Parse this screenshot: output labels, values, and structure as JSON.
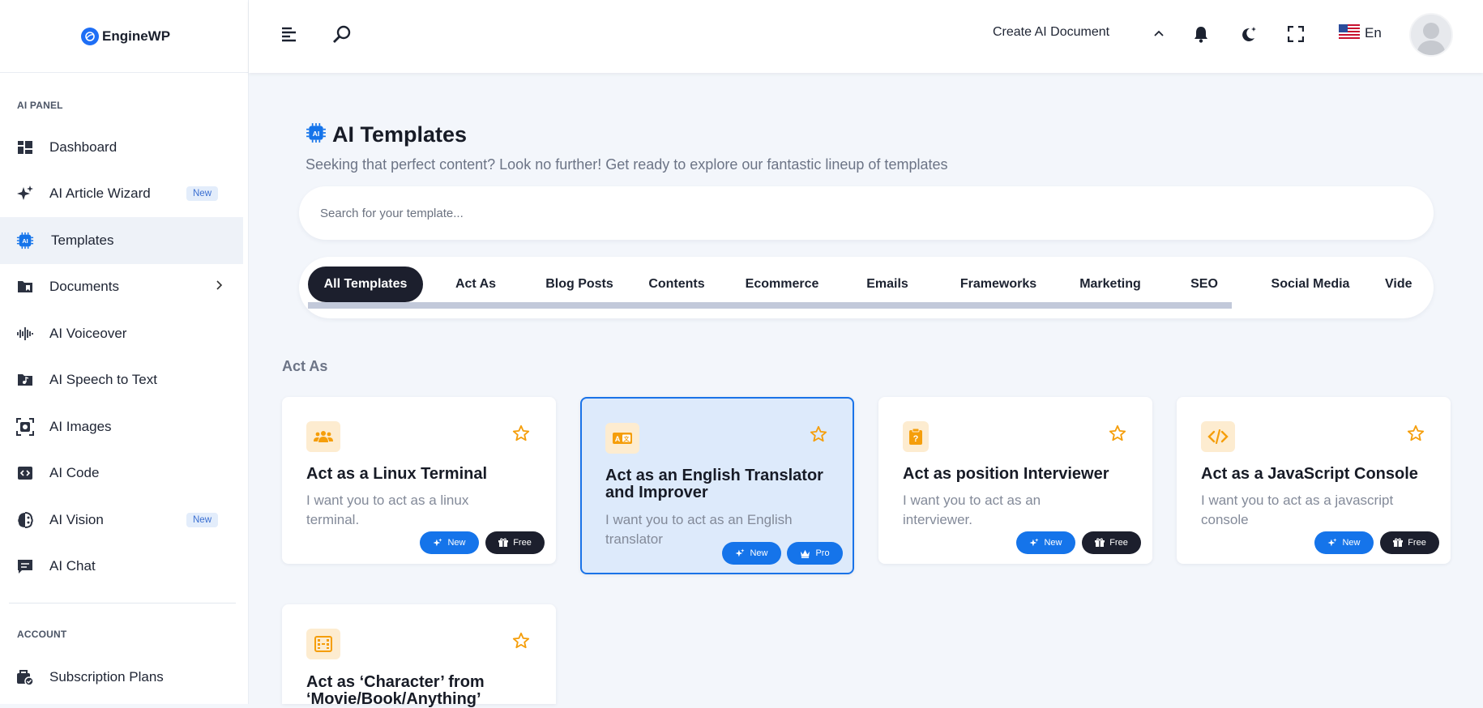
{
  "app": {
    "logo_text": "EngineWP"
  },
  "colors": {
    "accent": "#1574ea",
    "dark": "#1c1f2d",
    "icon_orange": "#f59e0b",
    "icon_bg": "#fdecd0",
    "highlight_bg": "#ddeafb"
  },
  "sidebar": {
    "section_ai": "AI PANEL",
    "section_account": "ACCOUNT",
    "items": [
      {
        "label": "Dashboard",
        "icon": "dashboard-icon"
      },
      {
        "label": "AI Article Wizard",
        "icon": "sparkles-icon",
        "badge": "New"
      },
      {
        "label": "Templates",
        "icon": "ai-chip-icon",
        "active": true
      },
      {
        "label": "Documents",
        "icon": "folder-icon",
        "chevron": true
      },
      {
        "label": "AI Voiceover",
        "icon": "waveform-icon"
      },
      {
        "label": "AI Speech to Text",
        "icon": "music-file-icon"
      },
      {
        "label": "AI Images",
        "icon": "image-scan-icon"
      },
      {
        "label": "AI Code",
        "icon": "code-icon"
      },
      {
        "label": "AI Vision",
        "icon": "brain-icon",
        "badge": "New"
      },
      {
        "label": "AI Chat",
        "icon": "chat-icon"
      }
    ],
    "account_items": [
      {
        "label": "Subscription Plans",
        "icon": "subscription-icon"
      }
    ]
  },
  "topbar": {
    "create_doc": "Create AI Document",
    "language": "En"
  },
  "main": {
    "title": "AI Templates",
    "subtitle": "Seeking that perfect content? Look no further! Get ready to explore our fantastic lineup of templates",
    "search_placeholder": "Search for your template...",
    "tabs": [
      "All Templates",
      "Act As",
      "Blog Posts",
      "Contents",
      "Ecommerce",
      "Emails",
      "Frameworks",
      "Marketing",
      "SEO",
      "Social Media",
      "Vide"
    ],
    "active_tab": "All Templates",
    "section_heading": "Act As",
    "cards": [
      {
        "title": "Act as a Linux Terminal",
        "desc": "I want you to act as a linux terminal.",
        "icon": "users-icon",
        "badges": [
          "New",
          "Free"
        ]
      },
      {
        "title": "Act as an English Translator and Improver",
        "desc": "I want you to act as an English translator",
        "icon": "translate-icon",
        "badges": [
          "New",
          "Pro"
        ],
        "highlighted": true
      },
      {
        "title": "Act as position Interviewer",
        "desc": "I want you to act as an interviewer.",
        "icon": "clipboard-icon",
        "badges": [
          "New",
          "Free"
        ]
      },
      {
        "title": "Act as a JavaScript Console",
        "desc": "I want you to act as a javascript console",
        "icon": "code-icon",
        "badges": [
          "New",
          "Free"
        ]
      },
      {
        "title": "Act as ‘Character’ from ‘Movie/Book/Anything’",
        "desc": "",
        "icon": "film-icon",
        "badges": []
      }
    ]
  }
}
